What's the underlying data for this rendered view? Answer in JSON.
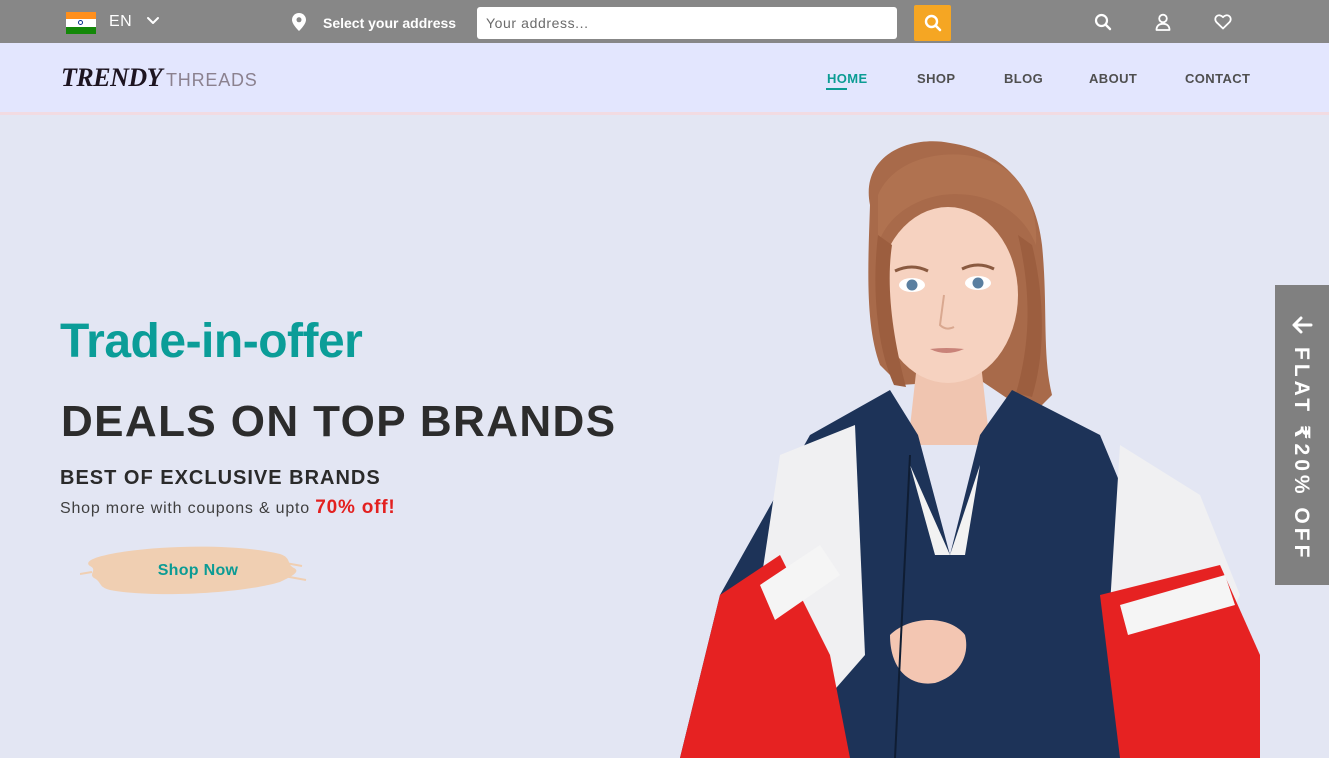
{
  "topbar": {
    "language": "EN",
    "address_label": "Select your address",
    "address_placeholder": "Your address...",
    "icons": [
      "flag-india-icon",
      "chevron-down-icon",
      "location-pin-icon",
      "search-icon",
      "user-icon",
      "heart-icon"
    ]
  },
  "navbar": {
    "logo_main": "TRENDY",
    "logo_sub": "THREADS",
    "items": [
      "HOME",
      "SHOP",
      "BLOG",
      "ABOUT",
      "CONTACT"
    ],
    "active_item": "HOME"
  },
  "hero": {
    "subtitle": "Trade-in-offer",
    "title": "DEALS ON TOP BRANDS",
    "heading": "BEST OF EXCLUSIVE BRANDS",
    "text": "Shop more with coupons & upto",
    "highlight": "70% off!",
    "button": "Shop Now"
  },
  "side_tab": {
    "text": "FLAT ₹20% OFF",
    "icon": "arrow-left-icon"
  },
  "colors": {
    "topbar_bg": "#878787",
    "navbar_bg": "#e3e6fe",
    "hero_bg": "#e3e6f3",
    "accent_teal": "#0b9d98",
    "search_button": "#f5a623",
    "offer_red": "#e3201f",
    "side_tab_bg": "#808080",
    "button_brush": "#f0cfb2"
  }
}
